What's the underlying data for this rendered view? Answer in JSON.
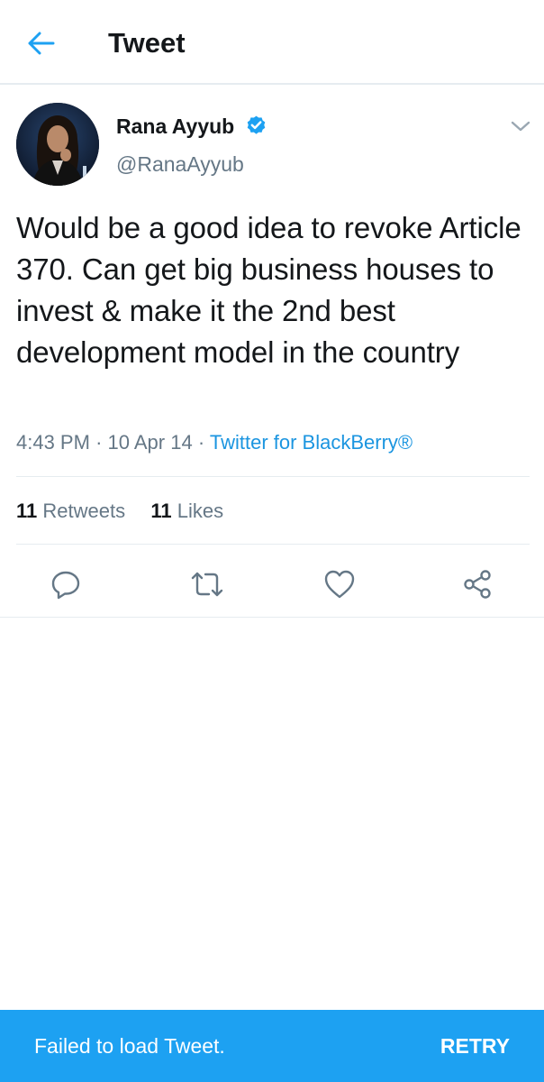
{
  "header": {
    "title": "Tweet",
    "back_icon": "arrow-left-icon"
  },
  "author": {
    "name": "Rana Ayyub",
    "handle": "@RanaAyyub",
    "verified": true,
    "verified_icon": "verified-badge-icon",
    "menu_icon": "chevron-down-icon"
  },
  "tweet": {
    "text": "Would be a good idea to revoke Article 370. Can get big business houses to invest & make it the 2nd best development model in the country",
    "time": "4:43 PM",
    "separator": "·",
    "date": "10 Apr 14",
    "source": "Twitter for BlackBerry®"
  },
  "stats": {
    "retweets_count": "11",
    "retweets_label": "Retweets",
    "likes_count": "11",
    "likes_label": "Likes"
  },
  "actions": [
    {
      "name": "reply",
      "icon": "reply-icon"
    },
    {
      "name": "retweet",
      "icon": "retweet-icon"
    },
    {
      "name": "like",
      "icon": "heart-icon"
    },
    {
      "name": "share",
      "icon": "share-icon"
    }
  ],
  "snackbar": {
    "message": "Failed to load Tweet.",
    "action": "RETRY"
  },
  "colors": {
    "accent": "#1da1f2",
    "link": "#1b95e0",
    "text_primary": "#14171a",
    "text_secondary": "#657786",
    "divider": "#e6ecf0"
  }
}
